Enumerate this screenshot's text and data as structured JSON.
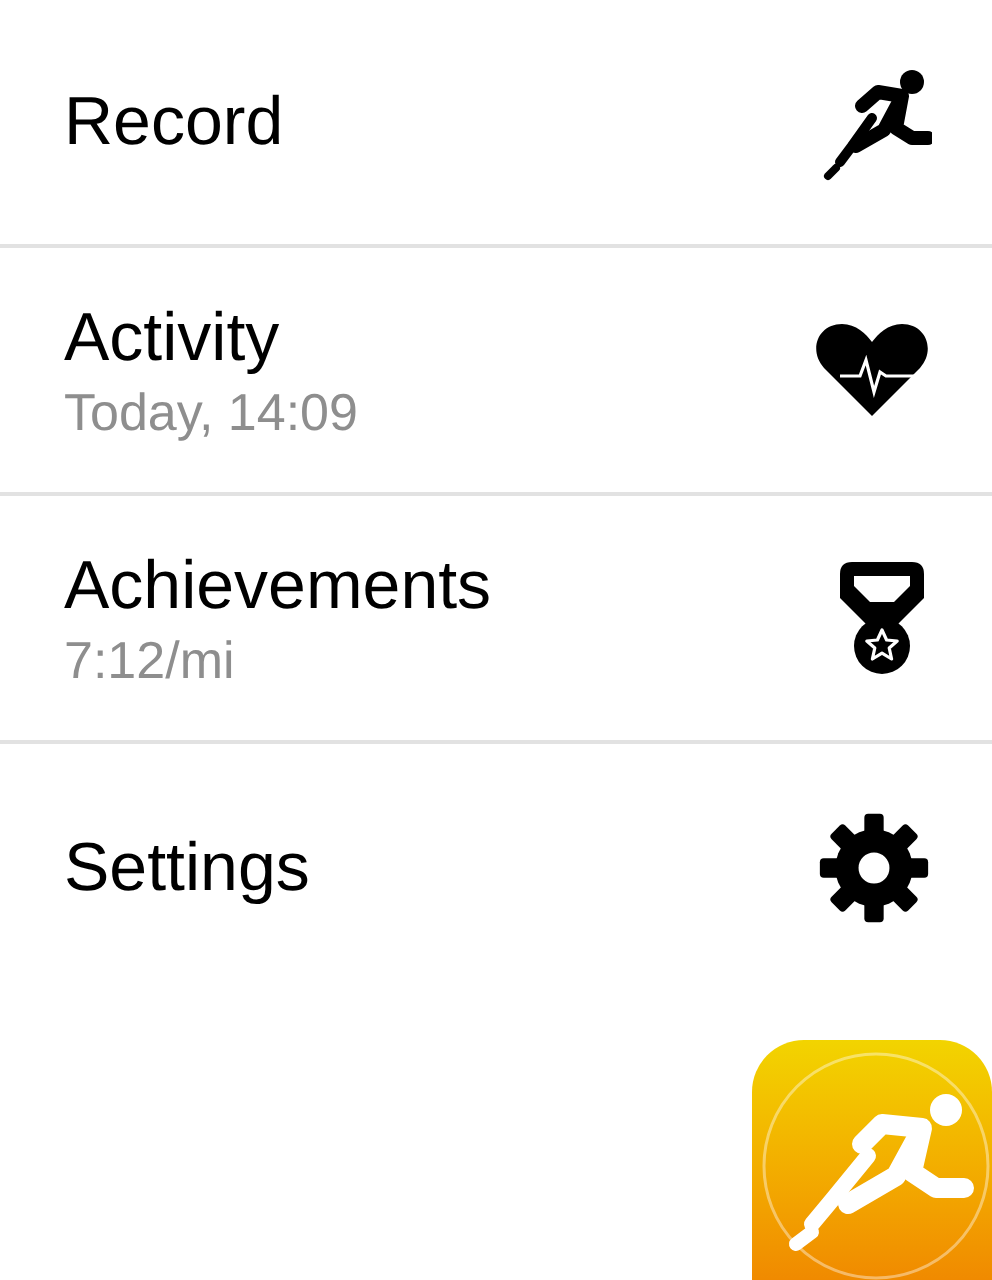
{
  "menu": [
    {
      "kind": "run",
      "title": "Record"
    },
    {
      "kind": "heart",
      "title": "Activity",
      "subtitle": "Today, 14:09"
    },
    {
      "kind": "medal",
      "title": "Achievements",
      "subtitle": "7:12/mi"
    },
    {
      "kind": "gear",
      "title": "Settings"
    }
  ]
}
